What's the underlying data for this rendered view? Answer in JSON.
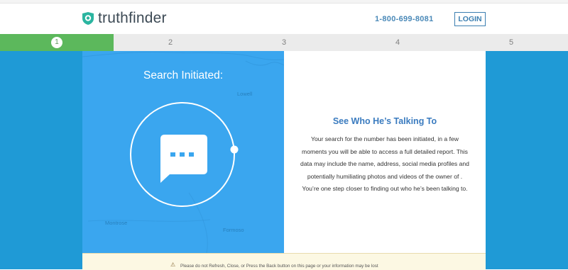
{
  "header": {
    "logo_text": "truthfinder",
    "phone": "1-800-699-8081",
    "login_label": "LOGIN",
    "brand_colors": {
      "teal": "#2bb5a0",
      "dark": "#3d4a55",
      "blue": "#3c7fb1"
    }
  },
  "steps": [
    {
      "label": "1",
      "active": true
    },
    {
      "label": "2",
      "active": false
    },
    {
      "label": "3",
      "active": false
    },
    {
      "label": "4",
      "active": false
    },
    {
      "label": "5",
      "active": false
    }
  ],
  "search_panel": {
    "title": "Search Initiated:",
    "map_labels": [
      "Lowell",
      "Montrose",
      "Formoso"
    ],
    "icon": "chat-bubble-icon"
  },
  "info_panel": {
    "title": "See Who He’s Talking To",
    "body": "Your search for the number has been initiated, in a few moments you will be able to access a full detailed report. This data may include the name, address, social media profiles and potentially humiliating photos and videos of the owner of . You’re one step closer to finding out who he’s been talking to."
  },
  "warning": {
    "icon": "warning-icon",
    "text": "Please do not Refresh, Close, or Press the Back button on this page or your information may be lost"
  },
  "colors": {
    "page_bg": "#1f9ad6",
    "panel_blue": "#3aa6ef",
    "step_active": "#5cb85c",
    "warning_bg": "#fcf8e3"
  }
}
